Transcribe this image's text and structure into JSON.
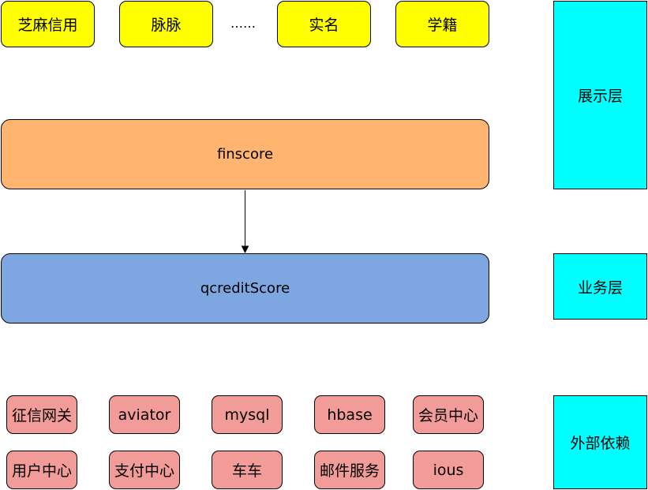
{
  "colors": {
    "presentation_fill": "#ffff00",
    "finscore_fill": "#ffb570",
    "qcredit_fill": "#7ea6e0",
    "dependency_fill": "#f19c99",
    "layer_fill": "#00ffff",
    "stroke": "#000000"
  },
  "presentation": {
    "items": [
      "芝麻信用",
      "脉脉",
      "……",
      "实名",
      "学籍"
    ]
  },
  "business": {
    "finscore": "finscore",
    "qcreditscore": "qcreditScore"
  },
  "dependencies": {
    "row1": [
      "征信网关",
      "aviator",
      "mysql",
      "hbase",
      "会员中心"
    ],
    "row2": [
      "用户中心",
      "支付中心",
      "车车",
      "邮件服务",
      "ious"
    ]
  },
  "layers": {
    "presentation": "展示层",
    "business": "业务层",
    "external": "外部依赖"
  }
}
